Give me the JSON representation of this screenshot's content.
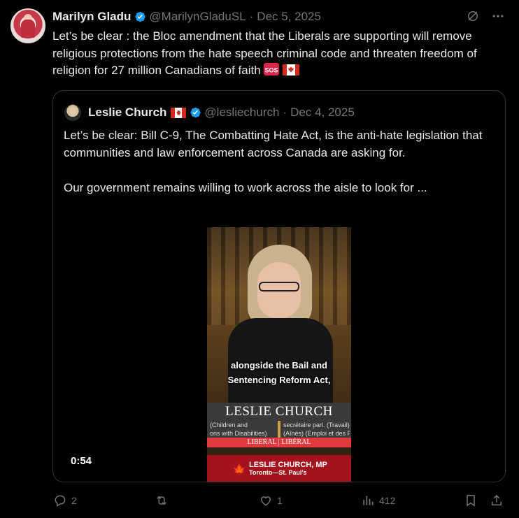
{
  "post": {
    "author_name": "Marilyn Gladu",
    "handle": "@MarilynGladuSL",
    "date": "Dec 5, 2025",
    "text": "Let’s be clear : the Bloc amendment that the Liberals are supporting will remove religious protections from the hate speech criminal code and threaten freedom of religion for 27 million Canadians of faith",
    "emoji_badge": "SOS"
  },
  "quote": {
    "author_name": "Leslie Church",
    "handle": "@lesliechurch",
    "date": "Dec 4, 2025",
    "paragraph1": "Let’s be clear: Bill C-9, The Combatting Hate Act, is the anti-hate legislation that communities and law enforcement across Canada are asking for.",
    "paragraph2": "Our government remains willing to work across the aisle to look for ..."
  },
  "video": {
    "caption_line1": "alongside the Bail and",
    "caption_line2": "Sentencing Reform Act,",
    "lower_third_name": "LESLIE CHURCH",
    "left_col_line1": "(Children and",
    "left_col_line2": "ons with Disabilities)",
    "right_col_line1": "secrétaire parl. (Travail) (",
    "right_col_line2": "(Aînés) (Emploi et des Fa",
    "party": "LIBERAL | LIBÉRAL",
    "mp_name": "LESLIE CHURCH, MP",
    "mp_riding": "Toronto—St. Paul’s",
    "duration": "0:54"
  },
  "actions": {
    "replies": "2",
    "reposts": "",
    "likes": "1",
    "views": "412"
  },
  "colors": {
    "background": "#000000",
    "text": "#e7e9ea",
    "muted": "#71767b",
    "verified": "#1d9bf0",
    "border": "#2f3336"
  }
}
